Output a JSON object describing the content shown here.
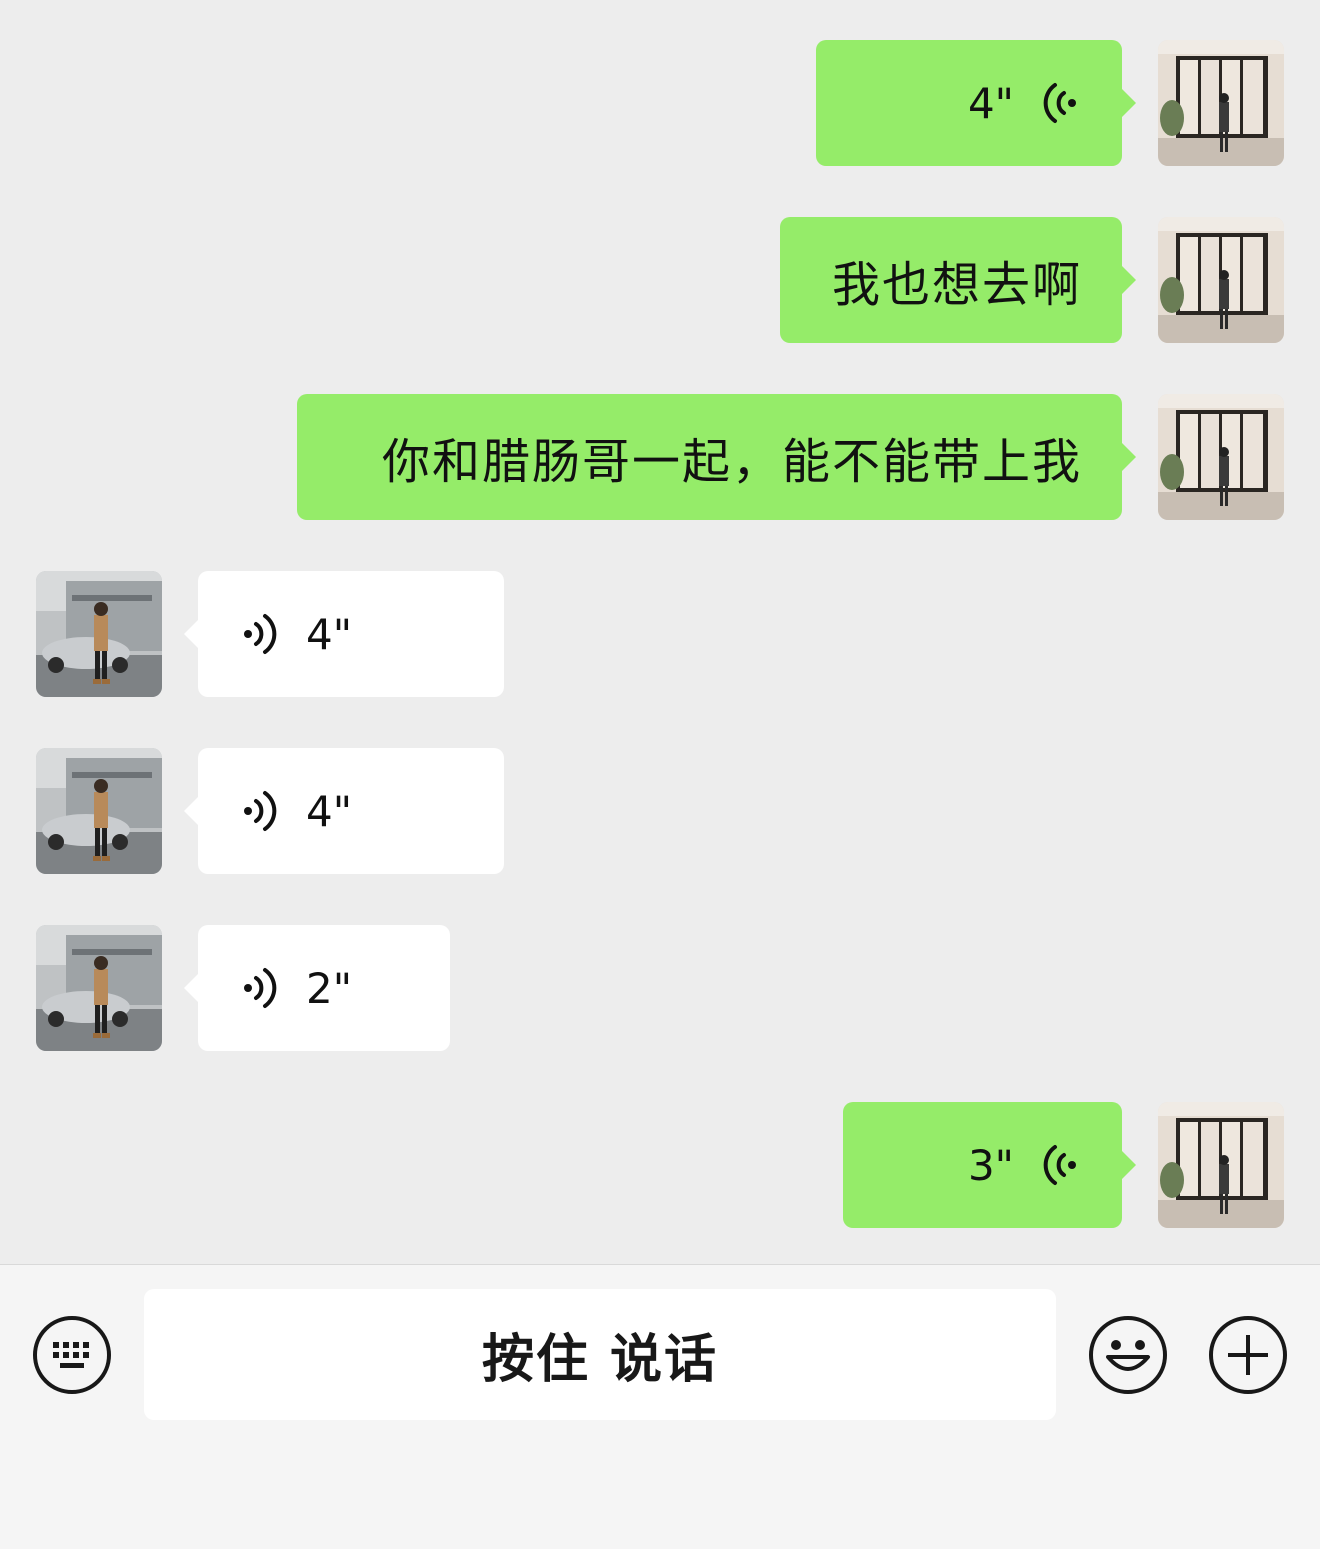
{
  "messages": [
    {
      "side": "out",
      "kind": "voice",
      "duration": "4\""
    },
    {
      "side": "out",
      "kind": "text",
      "text": "我也想去啊"
    },
    {
      "side": "out",
      "kind": "text",
      "text": "你和腊肠哥一起，能不能带上我"
    },
    {
      "side": "in",
      "kind": "voice",
      "duration": "4\""
    },
    {
      "side": "in",
      "kind": "voice",
      "duration": "4\""
    },
    {
      "side": "in",
      "kind": "voice",
      "duration": "2\""
    },
    {
      "side": "out",
      "kind": "voice",
      "duration": "3\""
    }
  ],
  "input_bar": {
    "talk_label": "按住 说话",
    "left_icon": "keyboard-icon",
    "right_icons": [
      "emoji-icon",
      "plus-icon"
    ]
  },
  "colors": {
    "outgoing_bubble": "#95ec69",
    "incoming_bubble": "#ffffff",
    "chat_background": "#ededed",
    "bar_background": "#f5f5f5"
  }
}
